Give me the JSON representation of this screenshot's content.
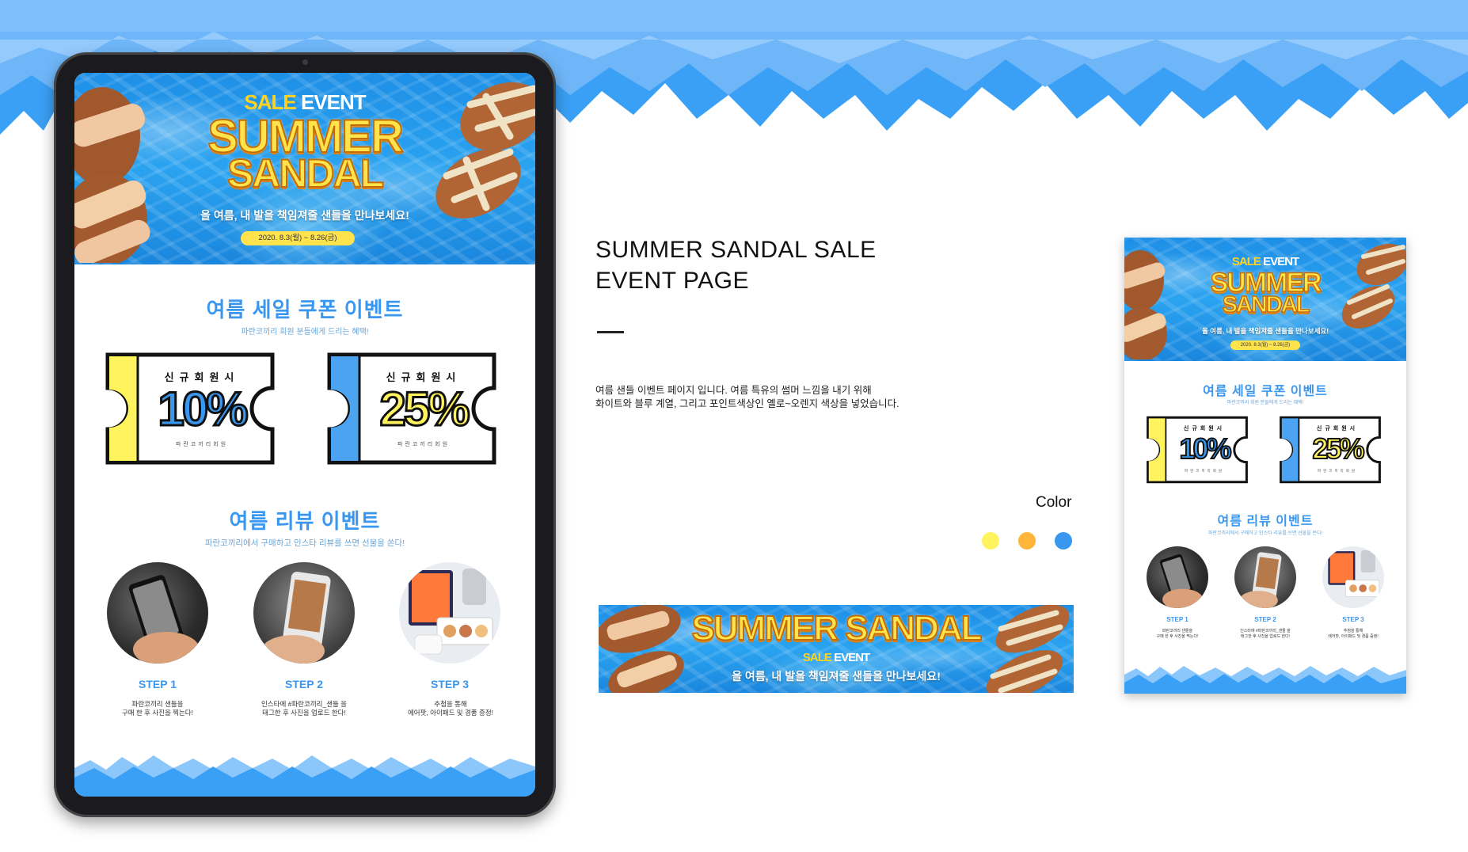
{
  "colors": {
    "sky_blue": "#7fbffa",
    "wave_blue": "#3aa0f5",
    "title_blue": "#3a97f0",
    "coupon_yellow": "#fff35e",
    "coupon_blue": "#4ba3f2",
    "swatch_yellow": "#fff35e",
    "swatch_orange": "#ffb43a",
    "swatch_blue": "#3a97f0"
  },
  "hero": {
    "sale": "SALE",
    "event": "EVENT",
    "title_line1": "SUMMER",
    "title_line2": "SANDAL",
    "subtitle": "올 여름, 내 발을 책임져줄 샌들을 만나보세요!",
    "date": "2020. 8.3(월) ~ 8.26(금)"
  },
  "coupon_section": {
    "title": "여름  세일 쿠폰 이벤트",
    "subtitle": "파란코끼리 회원 분들에게 드리는 혜택!",
    "coupons": [
      {
        "top": "신규회원시",
        "value": "10%",
        "footer": "파란코끼리회원"
      },
      {
        "top": "신규회원시",
        "value": "25%",
        "footer": "파란코끼리회원"
      }
    ]
  },
  "review_section": {
    "title": "여름 리뷰 이벤트",
    "subtitle": "파란코끼리에서 구매하고 인스타 리뷰를 쓰면 선물을 쏜다!",
    "steps": [
      {
        "label": "STEP 1",
        "desc_line1": "파란코끼리 샌들을",
        "desc_line2": "구매 한 후 사진을 찍는다!"
      },
      {
        "label": "STEP 2",
        "desc_line1": "인스타에 #파란코끼리_샌들 을",
        "desc_line2": "태그한 후 사진을 업로드 한다!"
      },
      {
        "label": "STEP 3",
        "desc_line1": "추첨을 통해",
        "desc_line2": "에어팟, 아이패드 및 경품 증정!"
      }
    ]
  },
  "info": {
    "title_line1": "SUMMER SANDAL SALE",
    "title_line2": "EVENT PAGE",
    "desc_line1": "여름 샌들 이벤트 페이지 입니다. 여름 특유의 썸머 느낌을 내기 위해",
    "desc_line2": "화이트와 블루 계열, 그리고 포인트색상인 옐로~오렌지 색상을 넣었습니다.",
    "color_label": "Color"
  },
  "banner": {
    "title": "SUMMER SANDAL",
    "sale": "SALE",
    "event": "EVENT",
    "subtitle": "올 여름, 내 발을 책임져줄 샌들을 만나보세요!"
  }
}
